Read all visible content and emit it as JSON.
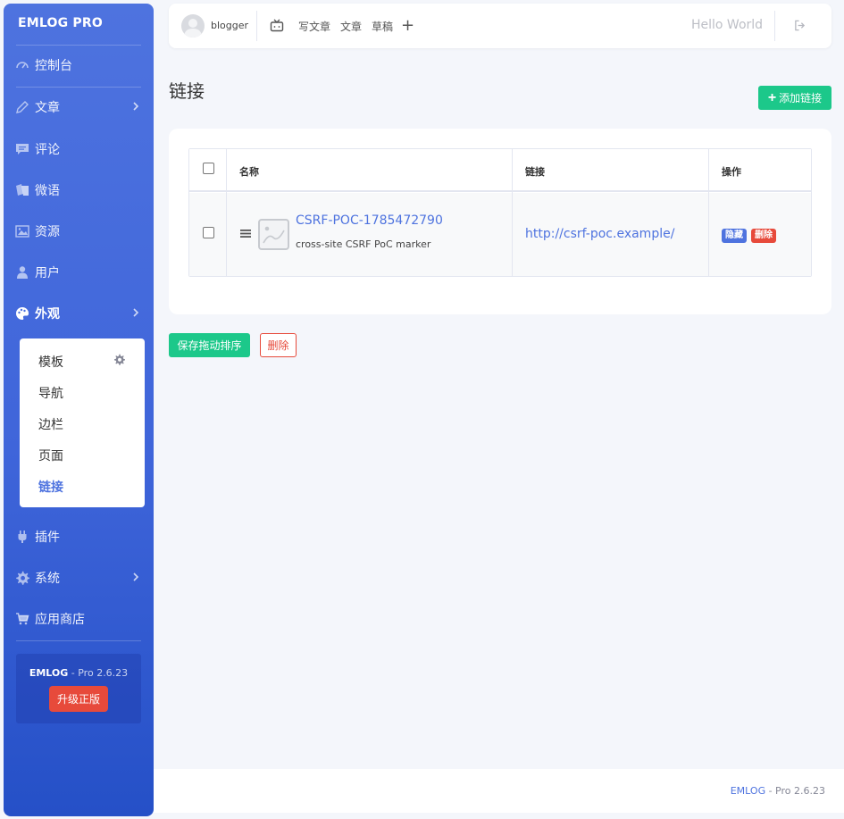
{
  "sidebar": {
    "brand": "EMLOG PRO",
    "items": [
      {
        "label": "控制台",
        "icon": "dashboard-icon"
      },
      {
        "label": "文章",
        "icon": "pencil-icon"
      },
      {
        "label": "评论",
        "icon": "comment-icon"
      },
      {
        "label": "微语",
        "icon": "cards-icon"
      },
      {
        "label": "资源",
        "icon": "image-icon"
      },
      {
        "label": "用户",
        "icon": "user-icon"
      },
      {
        "label": "外观",
        "icon": "palette-icon"
      },
      {
        "label": "插件",
        "icon": "plug-icon"
      },
      {
        "label": "系统",
        "icon": "gear-icon"
      },
      {
        "label": "应用商店",
        "icon": "cart-icon"
      }
    ],
    "submenu": [
      "模板",
      "导航",
      "边栏",
      "页面",
      "链接"
    ],
    "pro": {
      "brand": "EMLOG",
      "version": " - Pro 2.6.23",
      "upgrade": "升级正版"
    }
  },
  "topbar": {
    "username": "blogger",
    "links": [
      "写文章",
      "文章",
      "草稿"
    ],
    "plus": "+",
    "site_title": "Hello World"
  },
  "main": {
    "title": "链接",
    "add_button": "添加链接",
    "table": {
      "headers": [
        "名称",
        "链接",
        "操作"
      ],
      "rows": [
        {
          "name": "CSRF-POC-1785472790",
          "description": "cross-site CSRF PoC marker",
          "url": "http://csrf-poc.example/",
          "badge_hide": "隐藏",
          "badge_delete": "删除"
        }
      ]
    },
    "save_order": "保存拖动排序",
    "delete": "删除"
  },
  "footer": {
    "brand": "EMLOG",
    "version": " - Pro 2.6.23"
  },
  "colors": {
    "primary": "#4e73df",
    "success": "#1cc88a",
    "danger": "#e74a3b"
  }
}
